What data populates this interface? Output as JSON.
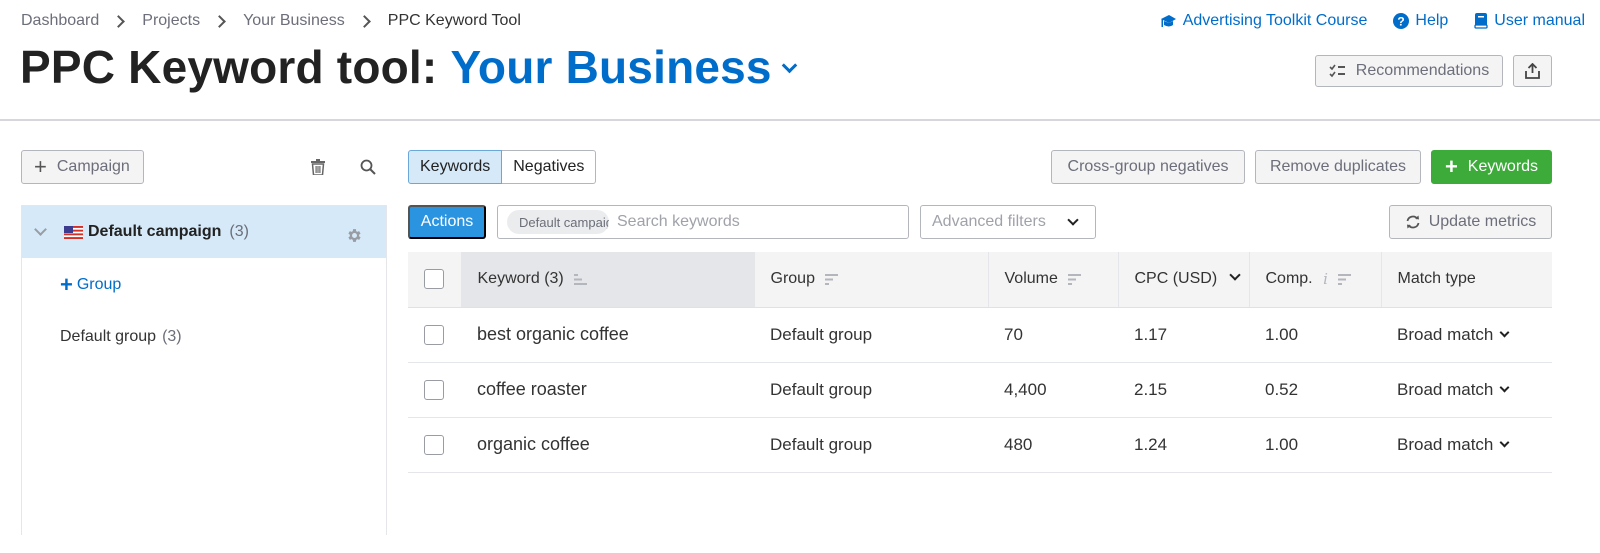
{
  "breadcrumb": [
    "Dashboard",
    "Projects",
    "Your Business",
    "PPC Keyword Tool"
  ],
  "header": {
    "title_prefix": "PPC Keyword tool:",
    "project_name": "Your Business",
    "links": [
      {
        "label": "Advertising Toolkit Course",
        "icon": "graduation-cap-icon"
      },
      {
        "label": "Help",
        "icon": "help-circle-icon"
      },
      {
        "label": "User manual",
        "icon": "book-icon"
      }
    ],
    "recommendations_label": "Recommendations",
    "export_icon": "export-upload-icon"
  },
  "sidebar": {
    "add_campaign_label": "Campaign",
    "campaign": {
      "name": "Default campaign",
      "count": "(3)",
      "flag": "us-flag"
    },
    "add_group_label": "Group",
    "groups": [
      {
        "name": "Default group",
        "count": "(3)"
      }
    ]
  },
  "main": {
    "tabs": [
      {
        "label": "Keywords",
        "active": true
      },
      {
        "label": "Negatives",
        "active": false
      }
    ],
    "cross_group_label": "Cross-group negatives",
    "remove_duplicates_label": "Remove duplicates",
    "add_keywords_label": "Keywords",
    "actions_label": "Actions",
    "search_chip": "Default campaign",
    "search_placeholder": "Search keywords",
    "advanced_filters_label": "Advanced filters",
    "update_metrics_label": "Update metrics"
  },
  "table": {
    "columns": [
      "Keyword (3)",
      "Group",
      "Volume",
      "CPC (USD)",
      "Comp.",
      "Match type"
    ],
    "rows": [
      {
        "keyword": "best organic coffee",
        "group": "Default group",
        "volume": "70",
        "cpc": "1.17",
        "comp": "1.00",
        "match": "Broad match"
      },
      {
        "keyword": "coffee roaster",
        "group": "Default group",
        "volume": "4,400",
        "cpc": "2.15",
        "comp": "0.52",
        "match": "Broad match"
      },
      {
        "keyword": "organic coffee",
        "group": "Default group",
        "volume": "480",
        "cpc": "1.24",
        "comp": "1.00",
        "match": "Broad match"
      }
    ]
  },
  "colors": {
    "link_blue": "#006dca",
    "primary_blue": "#2b94e1",
    "success_green": "#3dab3a",
    "selected_bg": "#d5e9f8"
  }
}
